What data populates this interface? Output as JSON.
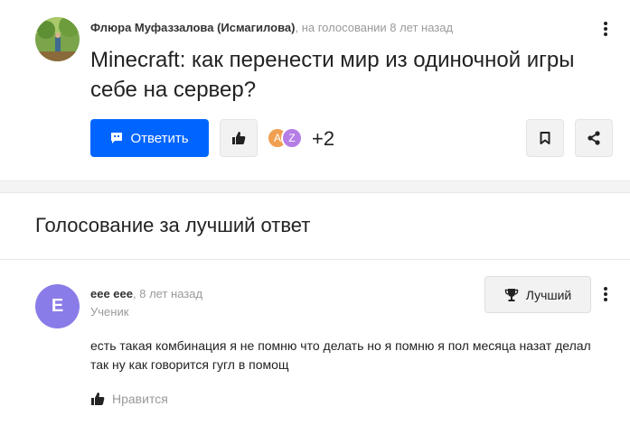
{
  "question": {
    "author": "Флюра Муфаззалова (Исмагилова)",
    "meta_suffix": ", на голосовании 8 лет назад",
    "title": "Minecraft: как перенести мир из одиночной игры себе на сервер?",
    "reply_label": "Ответить",
    "voter_avatars": [
      "A",
      "Z"
    ],
    "plus_count": "+2"
  },
  "voting": {
    "heading": "Голосование за лучший ответ"
  },
  "answer": {
    "avatar_letter": "E",
    "author": "eee eee",
    "time_suffix": ", 8 лет назад",
    "rank": "Ученик",
    "best_label": "Лучший",
    "text": "есть такая комбинация я не помню что делать но я помню я пол месяца назат делал так ну как говорится гугл в помощ",
    "like_label": "Нравится"
  },
  "colors": {
    "primary": "#0065ff",
    "avatar_e": "#8a7ce8",
    "avatar_a": "#f0a050",
    "avatar_z": "#b57ee6",
    "muted_text": "#9a9a9a"
  },
  "icons": {
    "more": "more-vertical-icon",
    "reply": "chat-bubble-icon",
    "like": "thumbs-up-icon",
    "bookmark": "bookmark-icon",
    "share": "share-icon",
    "trophy": "trophy-icon"
  }
}
